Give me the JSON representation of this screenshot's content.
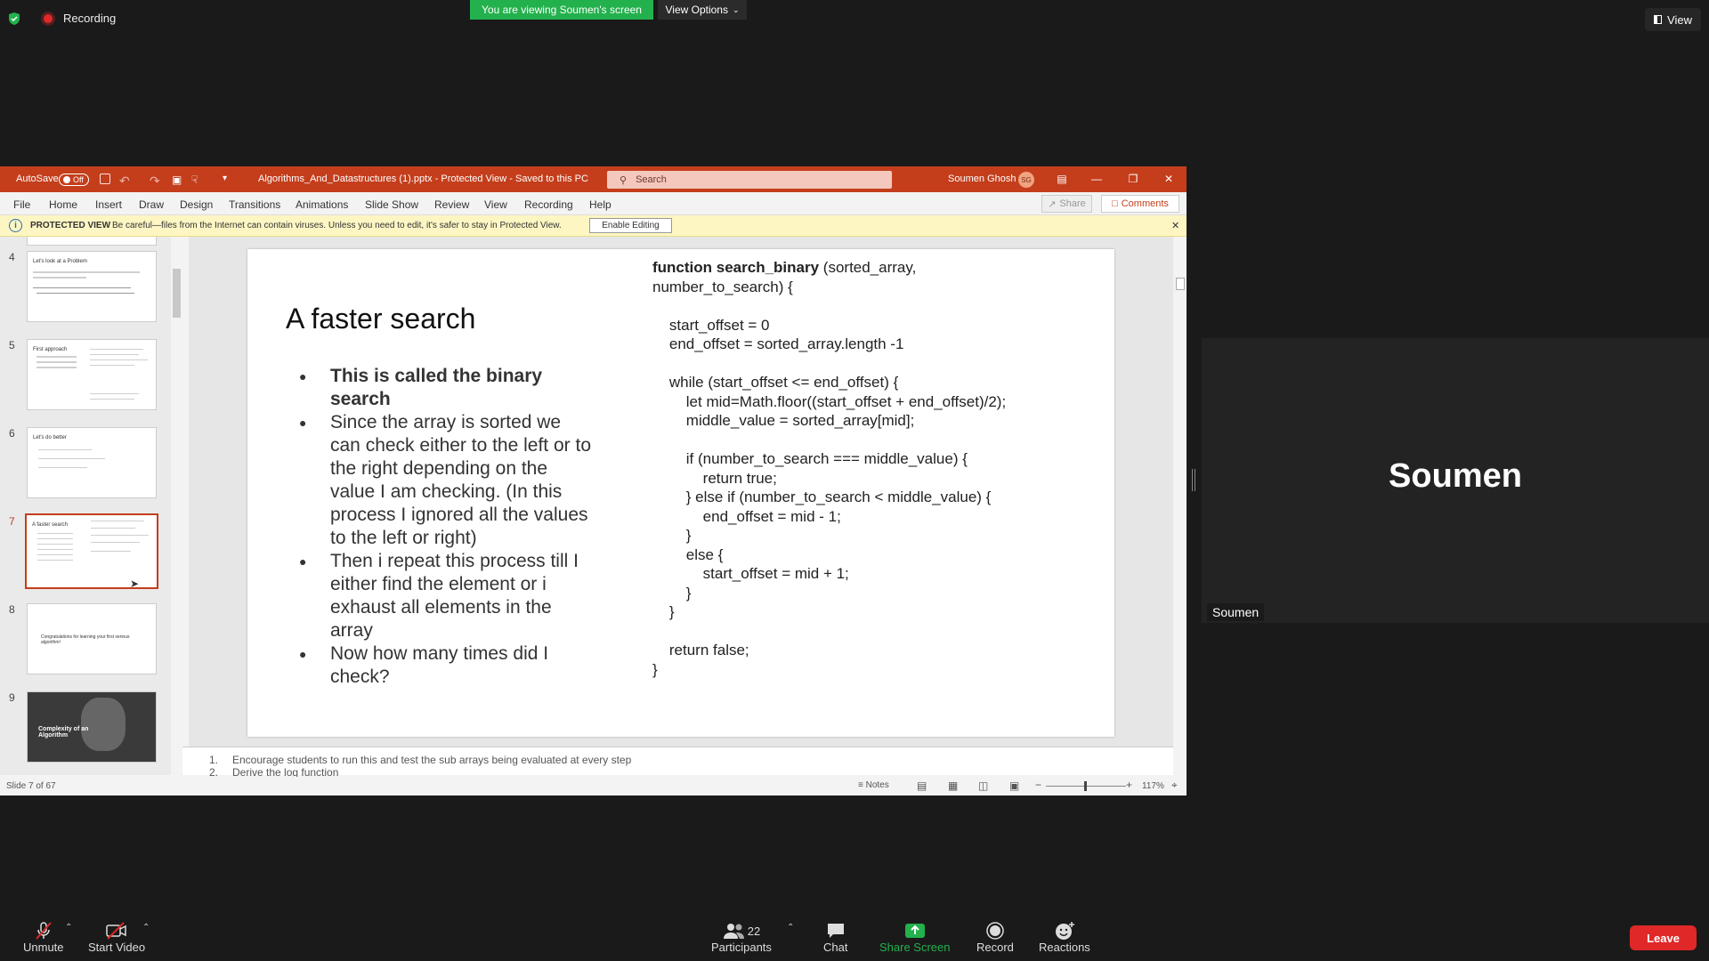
{
  "zoom_meeting": {
    "recording_label": "Recording",
    "viewing_banner": "You are viewing Soumen's screen",
    "view_options_label": "View Options",
    "view_label": "View",
    "participant_tile": {
      "display_name": "Soumen",
      "name_label": "Soumen"
    },
    "toolbar": {
      "unmute": "Unmute",
      "start_video": "Start Video",
      "participants": "Participants",
      "participants_count": "22",
      "chat": "Chat",
      "share_screen": "Share Screen",
      "record": "Record",
      "reactions": "Reactions",
      "leave": "Leave"
    },
    "colors": {
      "share_green": "#23b14d",
      "leave_red": "#e02828",
      "ppt_accent": "#c43e1c"
    }
  },
  "powerpoint": {
    "autosave_label": "AutoSave",
    "autosave_state": "Off",
    "file_title": "Algorithms_And_Datastructures (1).pptx - Protected View - Saved to this PC",
    "search_placeholder": "Search",
    "user_name": "Soumen Ghosh",
    "user_initials": "SG",
    "menus": [
      "File",
      "Home",
      "Insert",
      "Draw",
      "Design",
      "Transitions",
      "Animations",
      "Slide Show",
      "Review",
      "View",
      "Recording",
      "Help"
    ],
    "share_label": "Share",
    "comments_label": "Comments",
    "protected_view": {
      "label": "PROTECTED VIEW",
      "message": "Be careful—files from the Internet can contain viruses. Unless you need to edit, it's safer to stay in Protected View.",
      "enable_button": "Enable Editing"
    },
    "thumbnails": [
      {
        "number": "4",
        "title": "Let's look at a Problem"
      },
      {
        "number": "5",
        "title": "First approach"
      },
      {
        "number": "6",
        "title": "Let's do better"
      },
      {
        "number": "7",
        "title": "A faster search"
      },
      {
        "number": "8",
        "title": "Congratulations for learning your first serious algorithm!"
      },
      {
        "number": "9",
        "title": "Complexity of an Algorithm"
      }
    ],
    "slide": {
      "title": "A faster search",
      "bullets": [
        "This is called the binary search",
        "Since the array is sorted we can check either to the left or to the right depending on the value I am checking. (In this process I ignored all the values to the left or right)",
        "Then i repeat this process till I either find the element or i exhaust all elements in the array",
        "Now how many times did I check?"
      ],
      "code_fn": "function search_binary",
      "code_head_rest": " (sorted_array,",
      "code_body": "number_to_search) {\n\n    start_offset = 0\n    end_offset = sorted_array.length -1\n\n    while (start_offset <= end_offset) {\n        let mid=Math.floor((start_offset + end_offset)/2);\n        middle_value = sorted_array[mid];\n\n        if (number_to_search === middle_value) {\n            return true;\n        } else if (number_to_search < middle_value) {\n            end_offset = mid - 1;\n        }\n        else {\n            start_offset = mid + 1;\n        }\n    }\n\n    return false;\n}"
    },
    "notes": [
      {
        "num": "1.",
        "text": "Encourage students to run this and  test the sub arrays being evaluated at every step"
      },
      {
        "num": "2.",
        "text": "Derive the log function"
      }
    ],
    "status": {
      "slide_counter": "Slide 7 of 67",
      "notes_label": "Notes",
      "zoom": "117%"
    }
  }
}
